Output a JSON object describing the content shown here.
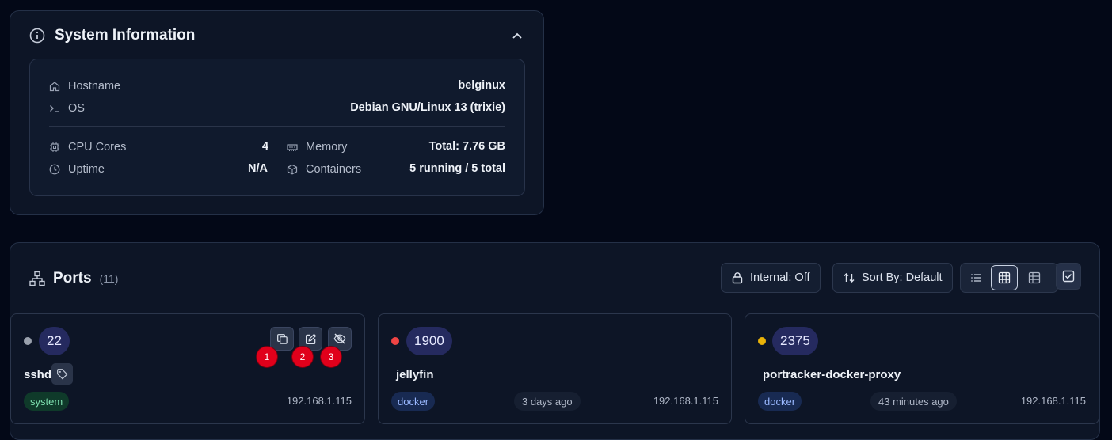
{
  "system_info": {
    "title": "System Information",
    "hostname": {
      "label": "Hostname",
      "value": "belginux"
    },
    "os": {
      "label": "OS",
      "value": "Debian GNU/Linux 13 (trixie)"
    },
    "cpu": {
      "label": "CPU Cores",
      "value": "4"
    },
    "uptime": {
      "label": "Uptime",
      "value": "N/A"
    },
    "memory": {
      "label": "Memory",
      "value": "Total: 7.76 GB"
    },
    "containers": {
      "label": "Containers",
      "value": "5 running / 5 total"
    }
  },
  "ports": {
    "title": "Ports",
    "count": "(11)",
    "internal_label": "Internal: Off",
    "sort_label": "Sort By: Default",
    "active_view": "grid",
    "cards": [
      {
        "port": "22",
        "name": "sshd",
        "source": "system",
        "time": "",
        "ip": "192.168.1.115",
        "status_color": "#9aa1ad",
        "tag_bg": "#0f3a2a",
        "tag_color": "#7fe0b0"
      },
      {
        "port": "1900",
        "name": "jellyfin",
        "source": "docker",
        "time": "3 days ago",
        "ip": "192.168.1.115",
        "status_color": "#ef4444",
        "tag_bg": "#182a52",
        "tag_color": "#9ab8ff"
      },
      {
        "port": "2375",
        "name": "portracker-docker-proxy",
        "source": "docker",
        "time": "43 minutes ago",
        "ip": "192.168.1.115",
        "status_color": "#eab308",
        "tag_bg": "#182a52",
        "tag_color": "#9ab8ff"
      }
    ],
    "action_markers": [
      "1",
      "2",
      "3"
    ]
  },
  "colors": {
    "background": "#030817",
    "panel": "#0d1526",
    "accent_pill": "#252a5f"
  }
}
